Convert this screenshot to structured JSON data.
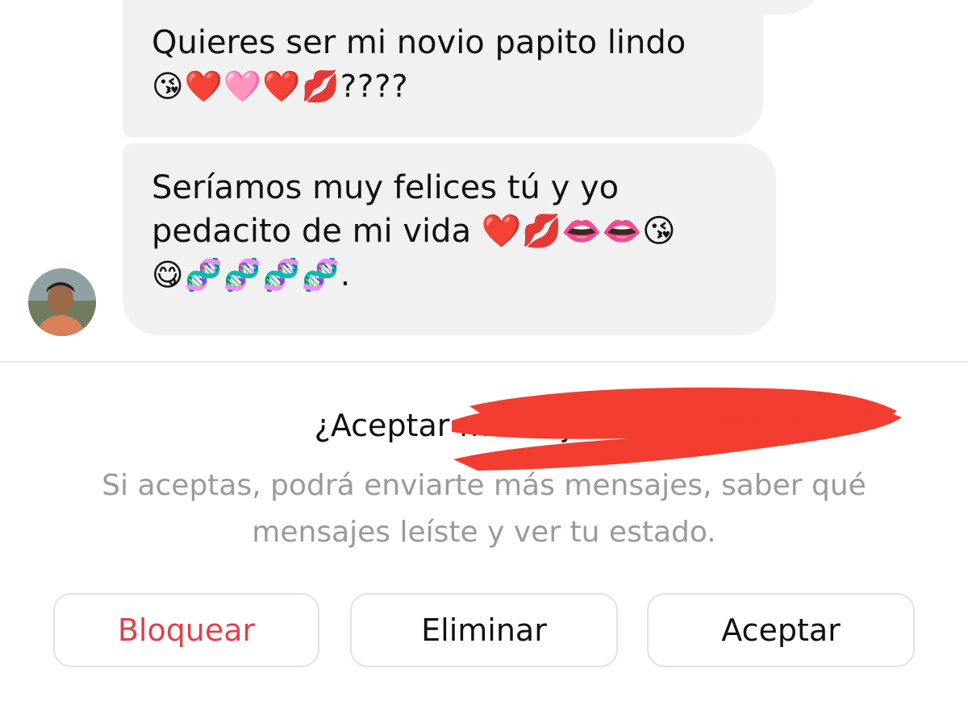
{
  "conversation": {
    "messages": [
      {
        "lines": [
          "Quieres ser mi novio papito lindo",
          "😘❤️🩷❤️💋????"
        ]
      },
      {
        "lines": [
          "Seríamos muy felices tú y yo",
          "pedacito de mi vida ❤️💋👄👄😘",
          "😋🧬🧬🧬🧬."
        ]
      }
    ],
    "sender_avatar": "avatar-photo"
  },
  "message_request": {
    "title": "¿Aceptar mensajes de",
    "description": "Si aceptas, podrá enviarte más mensajes, saber qué mensajes leíste y ver tu estado.",
    "redaction_color": "#f33d31"
  },
  "actions": {
    "block_label": "Bloquear",
    "delete_label": "Eliminar",
    "accept_label": "Aceptar"
  },
  "colors": {
    "bubble_bg": "#f1f1f1",
    "block_text": "#e0404c",
    "secondary_text": "#9a9a9a",
    "button_border": "#e2e2e2"
  }
}
